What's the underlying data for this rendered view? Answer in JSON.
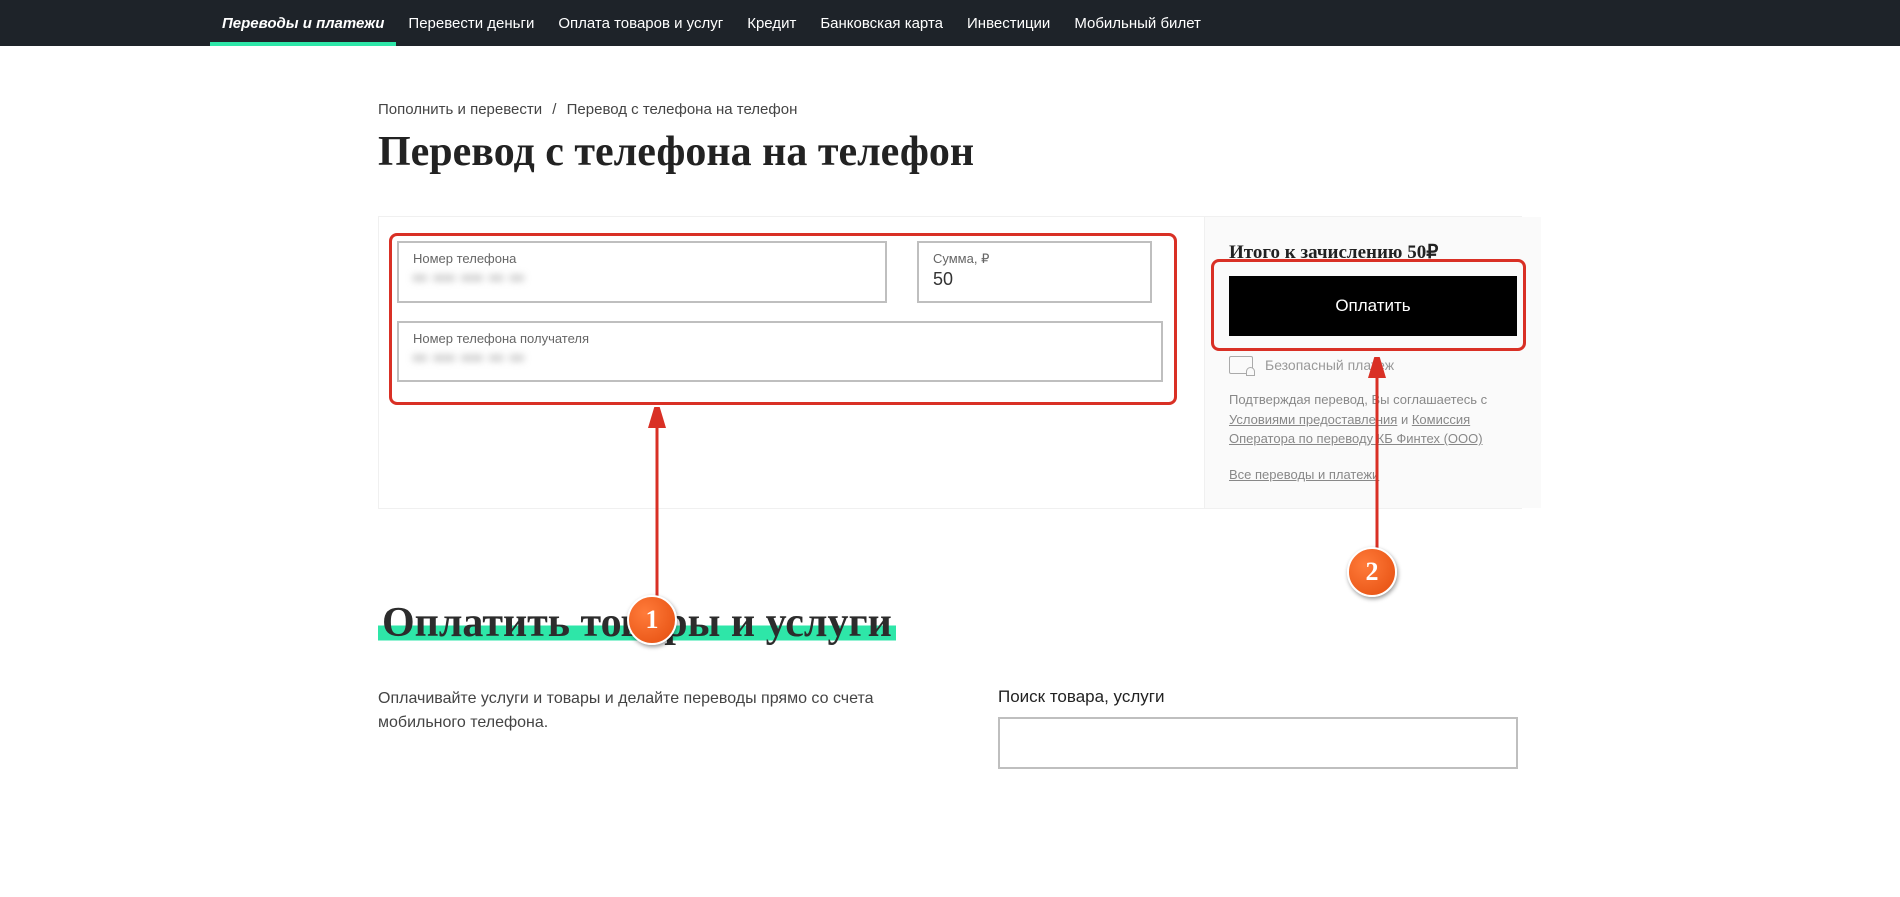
{
  "nav": [
    "Переводы и платежи",
    "Перевести деньги",
    "Оплата товаров и услуг",
    "Кредит",
    "Банковская карта",
    "Инвестиции",
    "Мобильный билет"
  ],
  "breadcrumb": {
    "parent": "Пополнить и перевести",
    "current": "Перевод с телефона на телефон"
  },
  "title": "Перевод с телефона на телефон",
  "form": {
    "phone_label": "Номер телефона",
    "phone_value": "•• ••• ••• •• ••",
    "amount_label": "Сумма, ₽",
    "amount_value": "50",
    "recipient_label": "Номер телефона получателя",
    "recipient_value": "•• ••• ••• •• ••"
  },
  "summary": {
    "total": "Итого к зачислению 50₽",
    "pay_button": "Оплатить",
    "secure": "Безопасный платеж",
    "terms_prefix": "Подтверждая перевод, Вы соглашаетесь с ",
    "terms_link1": "Условиями предоставления",
    "terms_mid": " и ",
    "terms_link2": "Комиссия Оператора по переводу КБ Финтех (ООО)",
    "all_link": "Все переводы и платежи"
  },
  "annotations": {
    "badge1": "1",
    "badge2": "2"
  },
  "section2": {
    "title": "Оплатить товары и услуги",
    "desc": "Оплачивайте услуги и товары и делайте переводы прямо со счета мобильного телефона.",
    "search_label": "Поиск товара, услуги"
  }
}
